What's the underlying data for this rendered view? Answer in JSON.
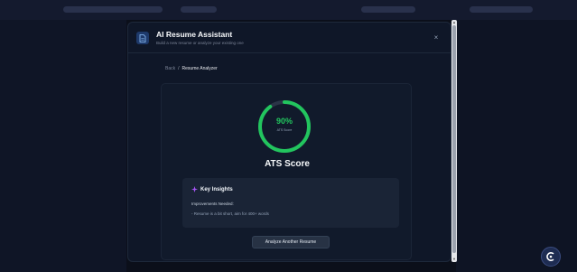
{
  "modal": {
    "title": "AI Resume Assistant",
    "subtitle": "Build a new resume or analyze your existing one",
    "close_label": "×"
  },
  "breadcrumb": {
    "back": "Back",
    "separator": "/",
    "current": "Resume Analyzer"
  },
  "score": {
    "value": "90%",
    "label": "ATS Score",
    "fraction": 0.9,
    "color": "#22c55e"
  },
  "ats_title": "ATS Score",
  "insights": {
    "icon": "sparkle-icon",
    "title": "Key Insights",
    "subtitle": "Improvements Needed:",
    "items": [
      "- Resume is a bit short, aim for 400+ words"
    ]
  },
  "analyze_button_label": "Analyze Another Resume",
  "icons": {
    "header": "document-icon",
    "fab": "assistant-icon"
  }
}
